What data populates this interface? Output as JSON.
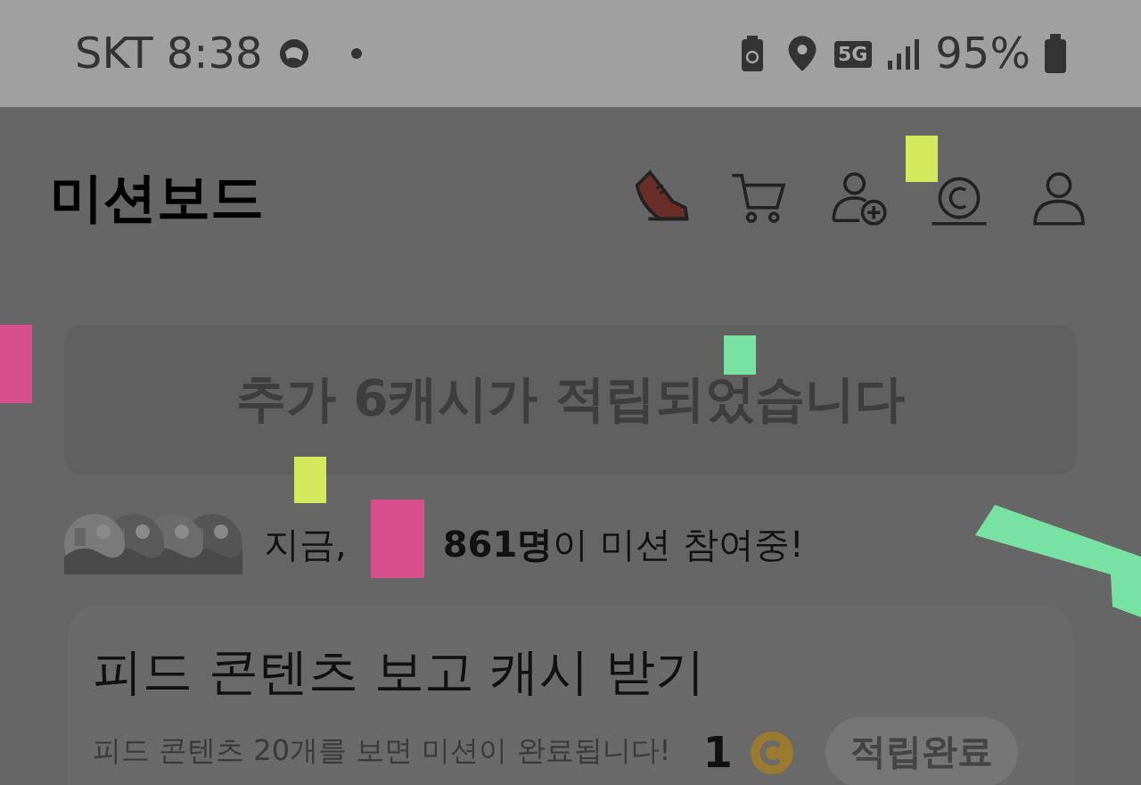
{
  "status_bar": {
    "carrier": "SKT",
    "time": "8:38",
    "network": "5G",
    "battery": "95%"
  },
  "header": {
    "title": "미션보드"
  },
  "banner": {
    "text": "추가 6캐시가 적립되었습니다"
  },
  "participants": {
    "prefix": "지금,",
    "text": "**861명**이 미션 참여중!"
  },
  "mission": {
    "title": "피드 콘텐츠 보고 캐시 받기",
    "description": "피드 콘텐츠 20개를 보면 미션이 완료됩니다!",
    "reward": "1",
    "button": {
      "label": "적립완료",
      "disabled": true
    }
  }
}
